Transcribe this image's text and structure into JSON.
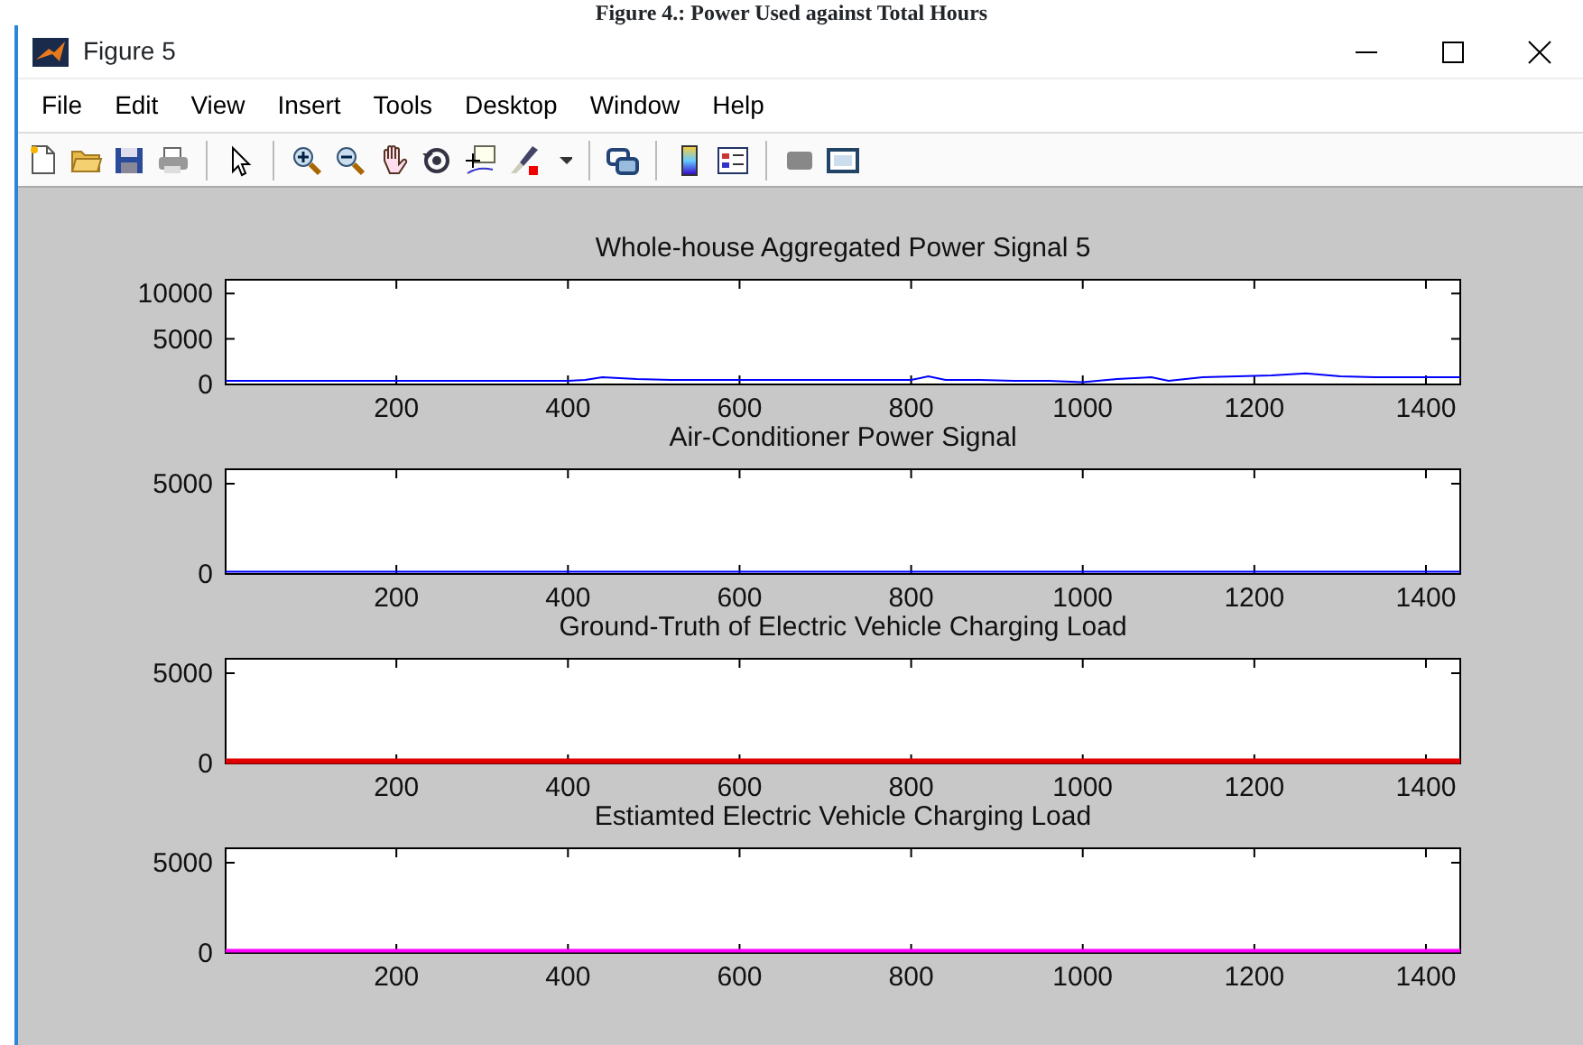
{
  "caption": "Figure 4.: Power Used against Total Hours",
  "window": {
    "title": "Figure 5"
  },
  "menu": [
    "File",
    "Edit",
    "View",
    "Insert",
    "Tools",
    "Desktop",
    "Window",
    "Help"
  ],
  "plots": [
    {
      "chart_data": {
        "type": "line",
        "title": "Whole-house Aggregated Power Signal 5",
        "xlim": [
          1,
          1440
        ],
        "ylim": [
          0,
          11500
        ],
        "xticks": [
          200,
          400,
          600,
          800,
          1000,
          1200,
          1400
        ],
        "yticks": [
          0,
          5000,
          10000
        ],
        "x": [
          1,
          40,
          80,
          120,
          160,
          200,
          240,
          280,
          320,
          360,
          400,
          420,
          440,
          480,
          520,
          560,
          600,
          640,
          680,
          720,
          760,
          800,
          820,
          840,
          880,
          920,
          960,
          1000,
          1040,
          1080,
          1100,
          1140,
          1180,
          1220,
          1260,
          1300,
          1340,
          1380,
          1420,
          1440
        ],
        "series": [
          {
            "color": "#0000ff",
            "values": [
              400,
              400,
              400,
              400,
              400,
              400,
              400,
              400,
              400,
              400,
              400,
              500,
              800,
              600,
              500,
              500,
              500,
              500,
              500,
              500,
              500,
              500,
              900,
              500,
              500,
              400,
              400,
              200,
              600,
              800,
              400,
              800,
              900,
              1000,
              1200,
              900,
              800,
              800,
              800,
              800
            ]
          }
        ]
      }
    },
    {
      "chart_data": {
        "type": "line",
        "title": "Air-Conditioner Power Signal",
        "xlim": [
          1,
          1440
        ],
        "ylim": [
          0,
          5800
        ],
        "xticks": [
          200,
          400,
          600,
          800,
          1000,
          1200,
          1400
        ],
        "yticks": [
          0,
          5000
        ],
        "x": [
          1,
          100,
          200,
          300,
          400,
          420,
          440,
          480,
          520,
          560,
          600,
          640,
          680,
          720,
          760,
          800,
          840,
          880,
          920,
          960,
          1000,
          1020,
          1060,
          1100,
          1140,
          1180,
          1220,
          1260,
          1300,
          1340,
          1380,
          1420,
          1440
        ],
        "series": [
          {
            "color": "#0000ff",
            "values": [
              0,
              0,
              0,
              0,
              0,
              100,
              100,
              100,
              100,
              100,
              0,
              100,
              0,
              0,
              0,
              100,
              0,
              0,
              0,
              0,
              0,
              100,
              100,
              100,
              100,
              100,
              100,
              100,
              0,
              100,
              100,
              100,
              100
            ]
          }
        ]
      }
    },
    {
      "chart_data": {
        "type": "line",
        "title": "Ground-Truth of Electric Vehicle Charging Load",
        "xlim": [
          1,
          1440
        ],
        "ylim": [
          0,
          5800
        ],
        "xticks": [
          200,
          400,
          600,
          800,
          1000,
          1200,
          1400
        ],
        "yticks": [
          0,
          5000
        ],
        "x": [
          1,
          1440
        ],
        "series": [
          {
            "color": "#e00000",
            "values": [
              0,
              0
            ]
          }
        ]
      }
    },
    {
      "chart_data": {
        "type": "line",
        "title": "Estiamted Electric Vehicle Charging Load",
        "xlim": [
          1,
          1440
        ],
        "ylim": [
          0,
          5800
        ],
        "xticks": [
          200,
          400,
          600,
          800,
          1000,
          1200,
          1400
        ],
        "yticks": [
          0,
          5000
        ],
        "x": [
          1,
          1440
        ],
        "series": [
          {
            "color": "#ff00ff",
            "values": [
              0,
              0
            ]
          }
        ]
      }
    }
  ]
}
